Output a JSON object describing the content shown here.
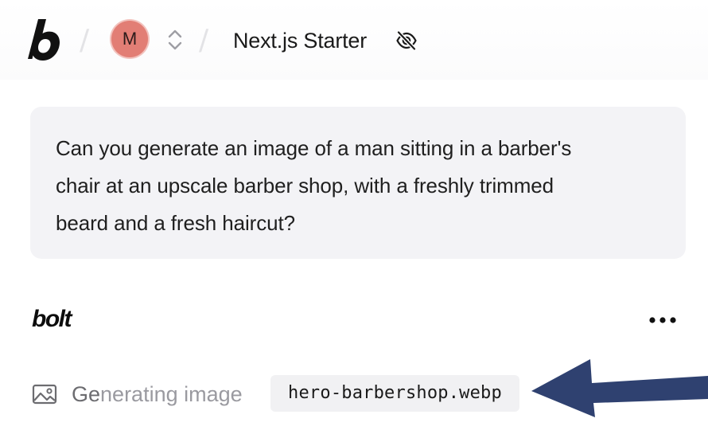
{
  "header": {
    "logo_letter": "b",
    "avatar_initial": "M",
    "project_title": "Next.js Starter",
    "visibility_icon": "eye-off-icon"
  },
  "prompt": {
    "text_lines": [
      "Can you generate an image of a man sitting in a barber's",
      "chair at an upscale barber shop, with a freshly trimmed",
      "beard and a fresh haircut?"
    ]
  },
  "assistant": {
    "name": "bolt",
    "more_icon": "more-horizontal-icon"
  },
  "generation": {
    "status_bright": "Ge",
    "status_dim": "nerating ",
    "status_tail": "image",
    "file_name": "hero-barbershop.webp",
    "icon": "image-icon"
  },
  "colors": {
    "avatar_bg": "#e27e75",
    "prompt_bg": "#f3f3f6",
    "arrow": "#2f4170"
  }
}
